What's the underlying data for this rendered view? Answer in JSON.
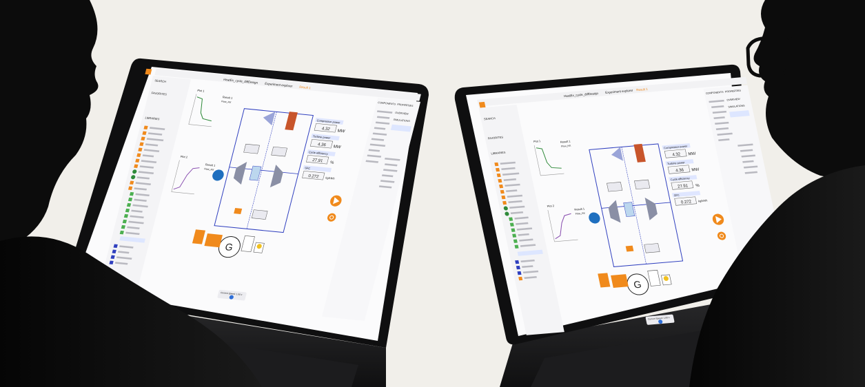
{
  "laptops": [
    {
      "tabs": [
        "HeatEx_cycle_diffDesign",
        "Experiment explorer",
        "Result 1"
      ],
      "readouts": {
        "compressor_power_label": "Compressor power",
        "compressor_power_value": "4.32",
        "compressor_power_unit": "MW",
        "turbine_power_label": "Turbine power",
        "turbine_power_value": "4.36",
        "turbine_power_unit": "MW",
        "cycle_efficiency_label": "Cycle efficiency",
        "cycle_efficiency_value": "27.91",
        "cycle_efficiency_unit": "%",
        "sfc_label": "SFC",
        "sfc_value": "0.272",
        "sfc_unit": "kg/kWh"
      },
      "plots": [
        {
          "title": "Plot 1",
          "legend_title": "Result 1",
          "legend_sub": "Flow_HX"
        },
        {
          "title": "Plot 2",
          "legend_title": "Result 1",
          "legend_sub": "Flow_HX"
        }
      ],
      "generator_label": "G",
      "panels": {
        "components_title": "COMPONENTS",
        "properties_title": "PROPERTIES",
        "overview_title": "OVERVIEW",
        "simulations_title": "SIMULATIONS"
      },
      "sidebar": {
        "search_label": "SEARCH",
        "libraries_label": "LIBRARIES",
        "favorites_label": "FAVORITES"
      },
      "speed_label": "Current Speed: 1.00 x"
    },
    {
      "tabs": [
        "HeatEx_cycle_diffDesign",
        "Experiment explorer",
        "Result 1"
      ],
      "readouts": {
        "compressor_power_label": "Compressor power",
        "compressor_power_value": "4.32",
        "compressor_power_unit": "MW",
        "turbine_power_label": "Turbine power",
        "turbine_power_value": "4.36",
        "turbine_power_unit": "MW",
        "cycle_efficiency_label": "Cycle efficiency",
        "cycle_efficiency_value": "27.91",
        "cycle_efficiency_unit": "%",
        "sfc_label": "SFC",
        "sfc_value": "0.272",
        "sfc_unit": "kg/kWh"
      },
      "plots": [
        {
          "title": "Plot 1",
          "legend_title": "Result 1",
          "legend_sub": "Flow_HX"
        },
        {
          "title": "Plot 2",
          "legend_title": "Result 1",
          "legend_sub": "Flow_HX"
        }
      ],
      "generator_label": "G",
      "panels": {
        "components_title": "COMPONENTS",
        "properties_title": "PROPERTIES",
        "overview_title": "OVERVIEW",
        "simulations_title": "SIMULATIONS"
      },
      "sidebar": {
        "search_label": "SEARCH",
        "libraries_label": "LIBRARIES",
        "favorites_label": "FAVORITES"
      },
      "speed_label": "Current Speed: 1.00 x"
    }
  ],
  "colors": {
    "background": "#f1efea",
    "accent_orange": "#f08a1c",
    "diagram_blue": "#2f3fbf",
    "readout_blue": "#dfe6ff",
    "plot_green": "#2f8a3a",
    "plot_purple": "#8a4fb0",
    "silhouette": "#0c0c0c"
  }
}
